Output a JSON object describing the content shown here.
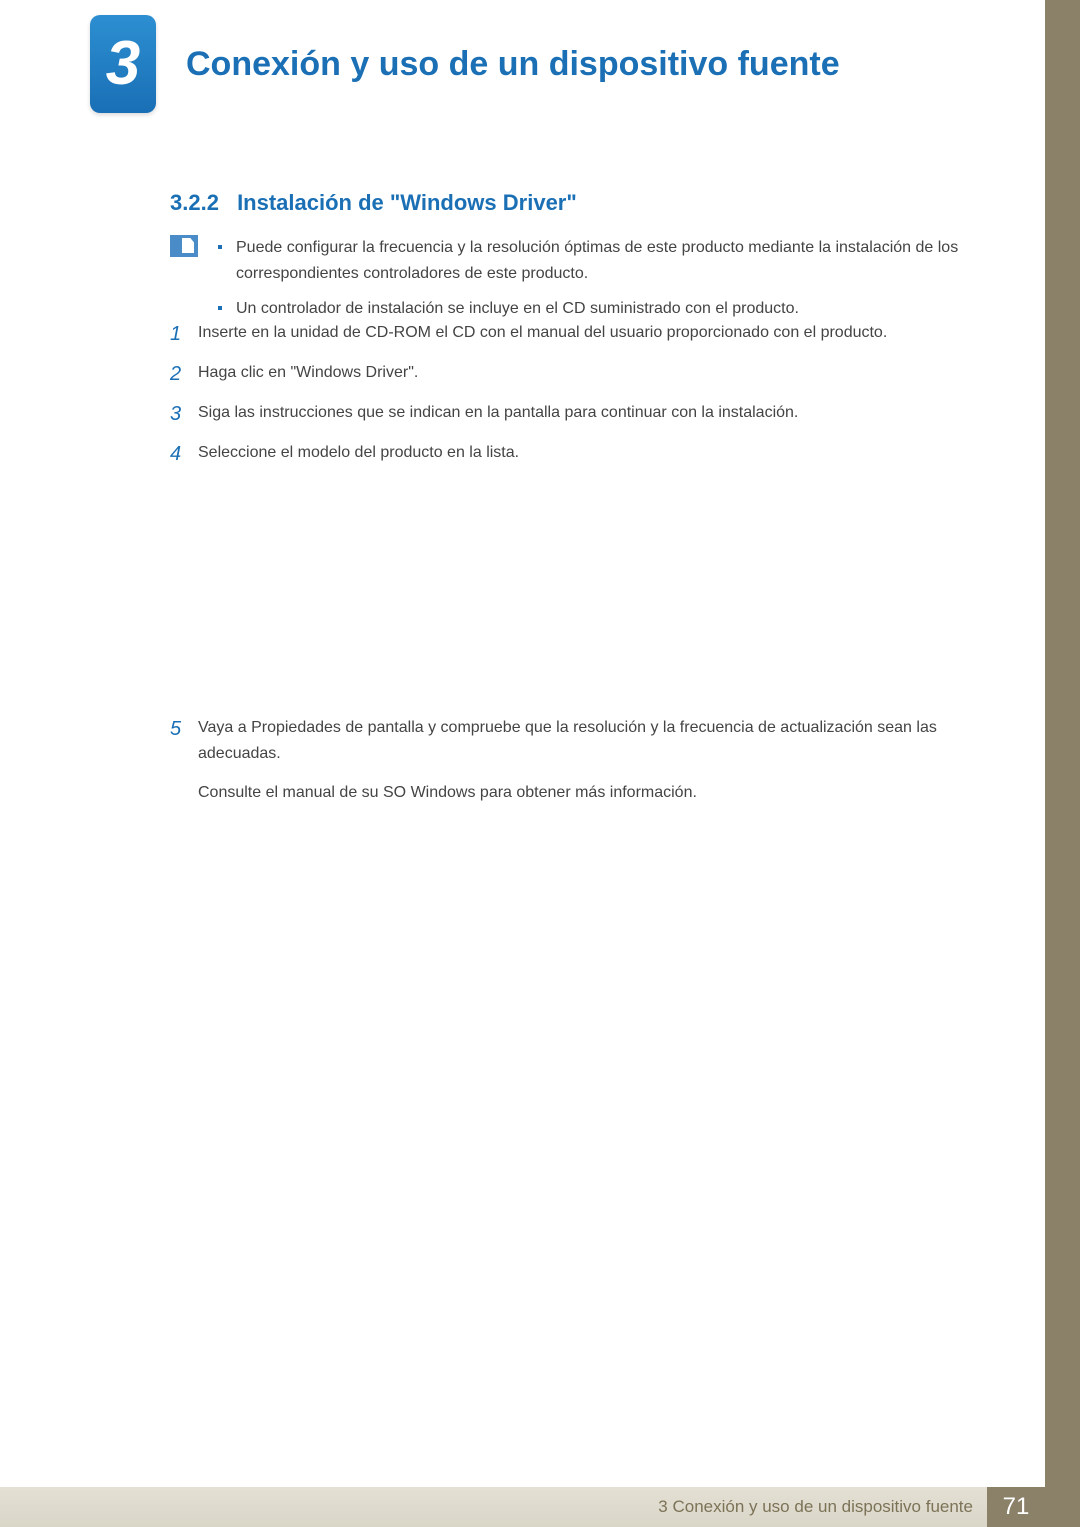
{
  "chapter": {
    "number": "3",
    "title": "Conexión y uso de un dispositivo fuente"
  },
  "section": {
    "number": "3.2.2",
    "title": "Instalación de \"Windows Driver\""
  },
  "notes": [
    "Puede configurar la frecuencia y la resolución óptimas de este producto mediante la instalación de los correspondientes controladores de este producto.",
    "Un controlador de instalación se incluye en el CD suministrado con el producto."
  ],
  "steps_a": [
    {
      "n": "1",
      "t": "Inserte en la unidad de CD-ROM el CD con el manual del usuario proporcionado con el producto."
    },
    {
      "n": "2",
      "t": "Haga clic en \"Windows Driver\"."
    },
    {
      "n": "3",
      "t": "Siga las instrucciones que se indican en la pantalla para continuar con la instalación."
    },
    {
      "n": "4",
      "t": "Seleccione el modelo del producto en la lista."
    }
  ],
  "steps_b": [
    {
      "n": "5",
      "t": "Vaya a Propiedades de pantalla y compruebe que la resolución y la frecuencia de actualización sean las adecuadas.",
      "extra": "Consulte el manual de su SO Windows para obtener más información."
    }
  ],
  "footer": {
    "title": "3 Conexión y uso de un dispositivo fuente",
    "page": "71"
  }
}
